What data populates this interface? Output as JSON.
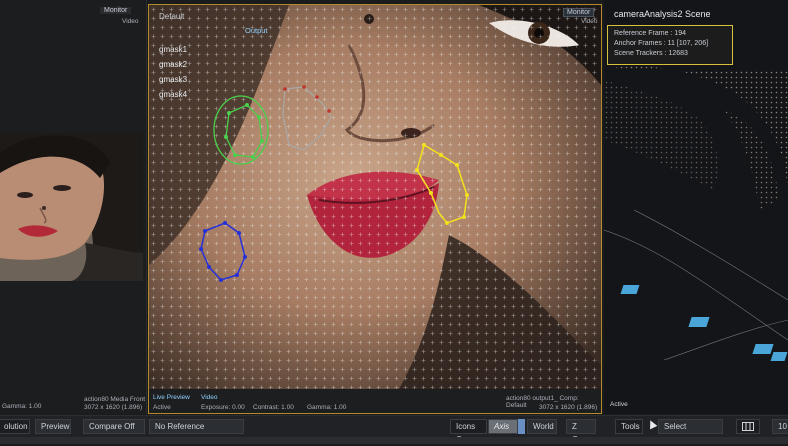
{
  "left_viewport": {
    "monitor_label": "Monitor",
    "video_label": "Video",
    "gamma_text": "Gamma: 1.00",
    "media_name": "action80 Media Front",
    "media_res": "3072 x 1620 (1.896)"
  },
  "center_viewport": {
    "view_name": "Default",
    "output_tab": "Output",
    "monitor_label": "Monitor",
    "video_label": "Video",
    "masks": [
      "gmask1",
      "gmask2",
      "gmask3",
      "gmask4"
    ],
    "live_preview": "Live Preview",
    "active_label": "Active",
    "video_text": "Video",
    "exposure": "Exposure: 0.00",
    "contrast": "Contrast: 1.00",
    "gamma": "Gamma: 1.00",
    "output_name": "action80 output1_ Comp: Default",
    "output_res": "3072 x 1620 (1.896)"
  },
  "right_viewport": {
    "scene_title": "cameraAnalysis2 Scene",
    "reference_frame": "Reference Frame : 194",
    "anchor_frames": "Anchor Frames : 11 [107, 206]",
    "scene_trackers": "Scene Trackers : 12683",
    "active_label": "Active"
  },
  "toolbar": {
    "resolution": "olution",
    "preview": "Preview",
    "compare": "Compare Off",
    "reference": "No Reference",
    "icons_on": "Icons On",
    "axis": "Axis",
    "world": "World",
    "z_occ": "Z Occ",
    "tools": "Tools",
    "select": "Select",
    "number_partial": "10"
  },
  "colors": {
    "accent_border": "#b58a2a",
    "scene_box_border": "#d8c23a",
    "mask_green": "#49d04a",
    "mask_gray": "#a8a8a8",
    "mask_yellow": "#f2e21c",
    "mask_blue": "#2530d8"
  }
}
